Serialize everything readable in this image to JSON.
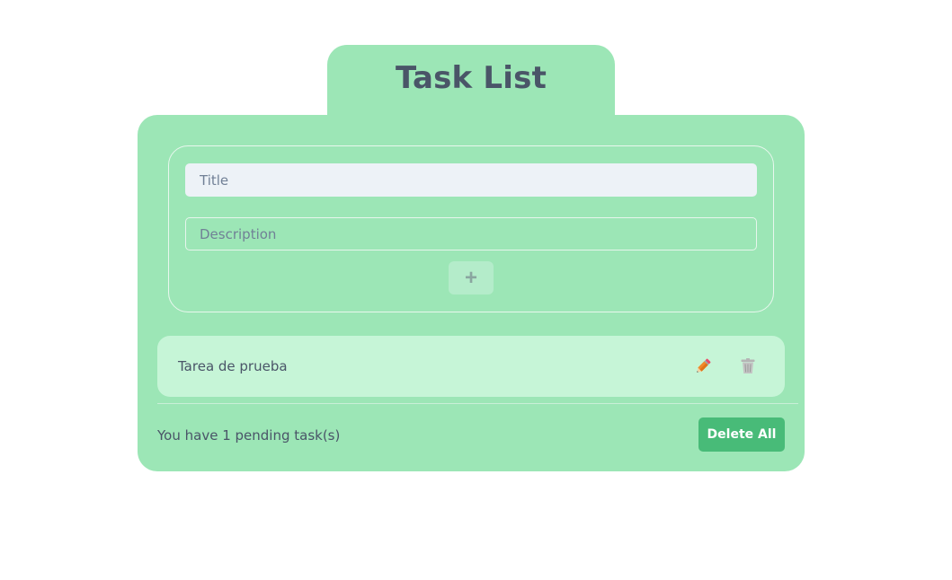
{
  "header": {
    "title": "Task List"
  },
  "form": {
    "title_placeholder": "Title",
    "title_value": "",
    "description_placeholder": "Description",
    "description_value": "",
    "add_button_label": "+"
  },
  "tasks": [
    {
      "title": "Tarea de prueba",
      "edit_icon": "pencil-icon",
      "delete_icon": "trash-icon"
    }
  ],
  "footer": {
    "pending_text": "You have 1 pending task(s)",
    "delete_all_label": "Delete All"
  },
  "colors": {
    "card_background": "#9ce6b6",
    "task_item_background": "#c6f5d7",
    "title_color": "#4a5568",
    "delete_all_background": "#48bb78"
  }
}
